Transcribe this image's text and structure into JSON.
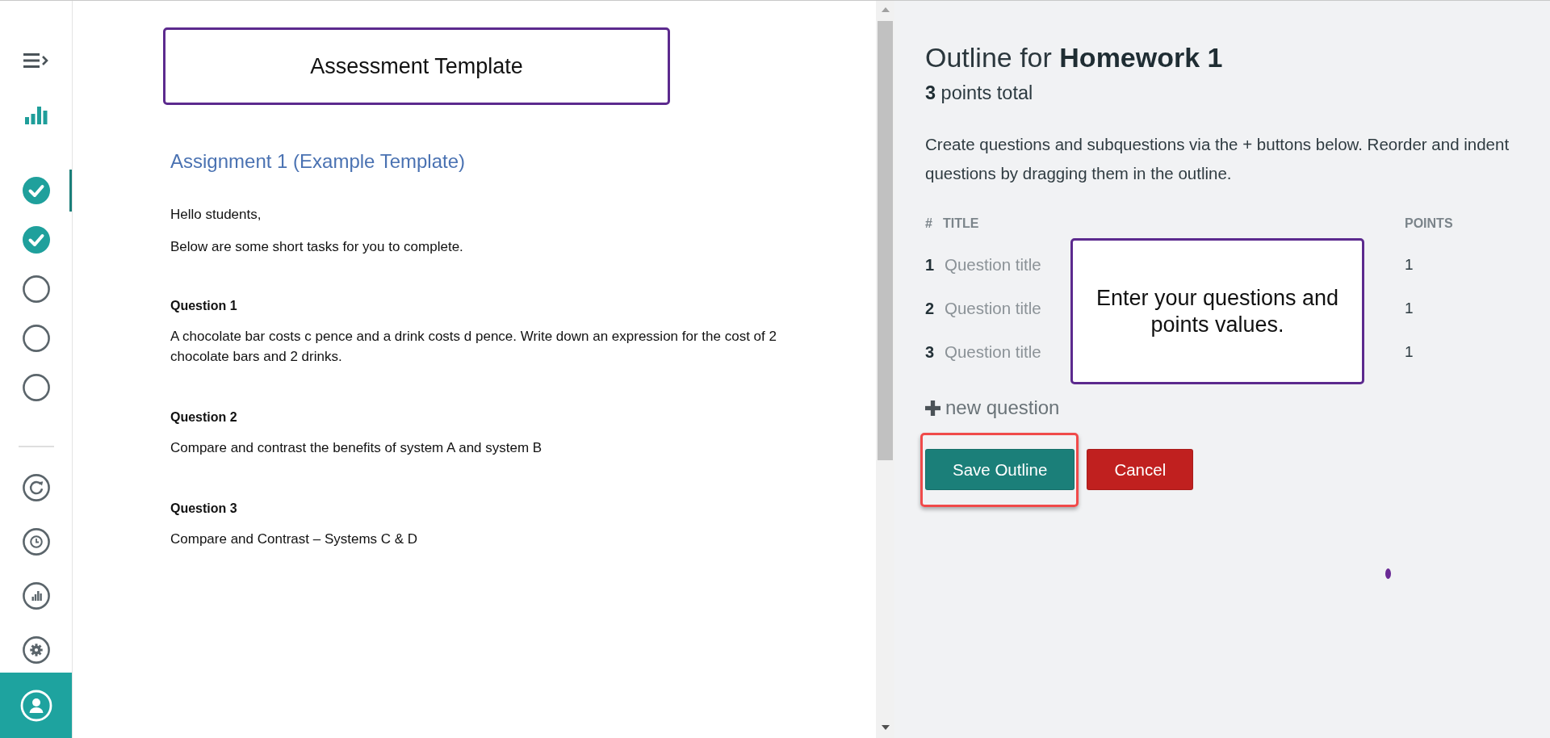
{
  "sidebar": {
    "steps": [
      {
        "completed": true,
        "selected": true
      },
      {
        "completed": true,
        "selected": false
      },
      {
        "completed": false,
        "selected": false
      },
      {
        "completed": false,
        "selected": false
      },
      {
        "completed": false,
        "selected": false
      }
    ]
  },
  "document": {
    "banner": "Assessment Template",
    "title": "Assignment 1 (Example Template)",
    "greeting": "Hello students,",
    "intro": "Below are some short tasks for you to complete.",
    "questions": [
      {
        "heading": "Question 1",
        "body": "A chocolate bar costs c pence and a drink costs d pence. Write down an expression for the cost of 2 chocolate bars and 2 drinks."
      },
      {
        "heading": "Question 2",
        "body": "Compare and contrast the benefits of system A and system B"
      },
      {
        "heading": "Question 3",
        "body": "Compare and Contrast – Systems C & D"
      }
    ]
  },
  "outline": {
    "title": "Outline for **Homework 1**",
    "points_total": "**3** points total",
    "instructions": "Create questions and subquestions via the + buttons below. Reorder and indent questions by dragging them in the outline.",
    "columns": [
      "#",
      "TITLE",
      "POINTS"
    ],
    "questions": [
      {
        "number": "1",
        "placeholder": "Question title",
        "points": "1"
      },
      {
        "number": "2",
        "placeholder": "Question title",
        "points": "1"
      },
      {
        "number": "3",
        "placeholder": "Question title",
        "points": "1"
      }
    ],
    "add_question": "new question",
    "buttons": [
      {
        "label": "Save Outline",
        "kind": "primary",
        "highlighted": true
      },
      {
        "label": "Cancel",
        "kind": "danger",
        "highlighted": false
      }
    ],
    "callout": "Enter your questions and points values."
  }
}
